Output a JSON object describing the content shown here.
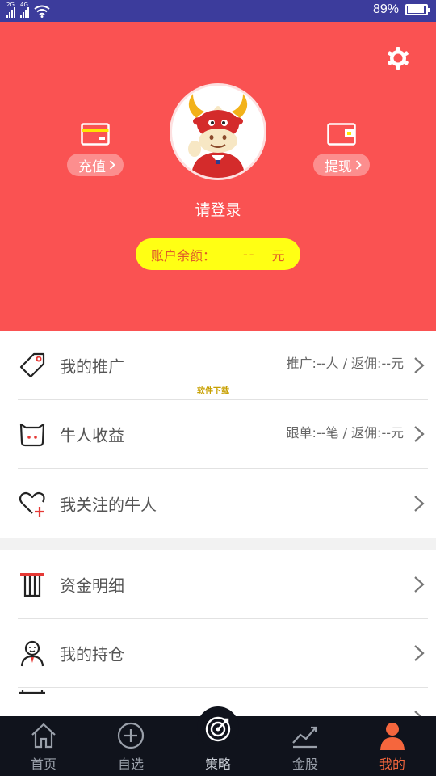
{
  "status_bar": {
    "net1": "2G",
    "net2": "4G",
    "battery": "89%",
    "battery_level": 0.89
  },
  "header": {
    "recharge_label": "充值",
    "withdraw_label": "提现",
    "login_text": "请登录",
    "balance_label": "账户余额：",
    "balance_value": "--",
    "balance_unit": "元"
  },
  "menu_group1": [
    {
      "label": "我的推广",
      "meta": "推广:--人 / 返佣:--元"
    },
    {
      "label": "牛人收益",
      "meta": "跟单:--笔 / 返佣:--元"
    },
    {
      "label": "我关注的牛人",
      "meta": ""
    }
  ],
  "menu_group2": [
    {
      "label": "资金明细"
    },
    {
      "label": "我的持仓"
    }
  ],
  "watermark": "软件下载",
  "nav": [
    {
      "label": "首页",
      "icon": "home-icon"
    },
    {
      "label": "自选",
      "icon": "plus-circle-icon"
    },
    {
      "label": "策略",
      "icon": "target-icon"
    },
    {
      "label": "金股",
      "icon": "trend-chart-icon"
    },
    {
      "label": "我的",
      "icon": "person-icon",
      "active": true
    }
  ],
  "colors": {
    "header_bg": "#fa5252",
    "balance_bg": "#ffff14",
    "nav_bg": "#10131c",
    "active": "#f5663d",
    "status_bar": "#3c3c9c"
  }
}
